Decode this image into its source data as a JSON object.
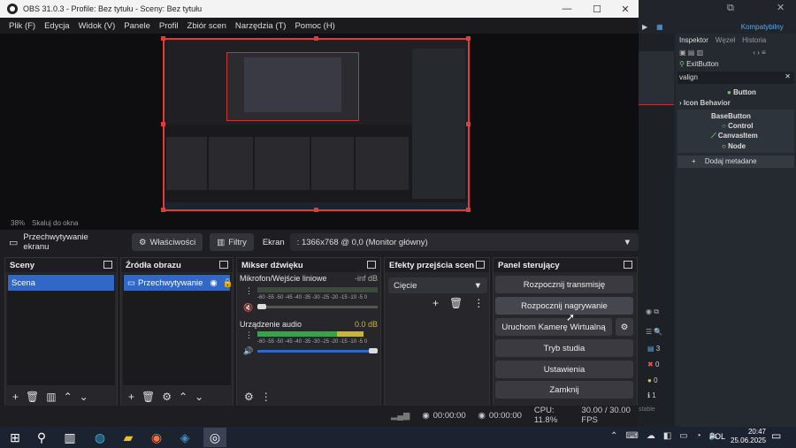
{
  "window": {
    "title": "OBS 31.0.3 - Profile: Bez tytułu - Sceny: Bez tytułu",
    "minimize": "—",
    "maximize": "☐",
    "close": "✕"
  },
  "menu": [
    "Plik (F)",
    "Edycja",
    "Widok (V)",
    "Panele",
    "Profil",
    "Zbiór scen",
    "Narzędzia (T)",
    "Pomoc (H)"
  ],
  "preview": {
    "zoom": "38%",
    "fit_label": "Skaluj do okna"
  },
  "source_bar": {
    "source_name": "Przechwytywanie ekranu",
    "properties": "Właściwości",
    "filters": "Filtry",
    "screen_label": "Ekran",
    "screen_value": ": 1366x768 @ 0,0 (Monitor główny)"
  },
  "scenes": {
    "title": "Sceny",
    "items": [
      "Scena"
    ]
  },
  "sources": {
    "title": "Źródła obrazu",
    "items": [
      "Przechwytywanie"
    ]
  },
  "mixer": {
    "title": "Mikser dźwięku",
    "channels": [
      {
        "name": "Mikrofon/Wejście liniowe",
        "level": "-inf dB",
        "muted": true,
        "volume": 0.05
      },
      {
        "name": "Urządzenie audio",
        "level": "0.0 dB",
        "muted": false,
        "volume": 1.0
      }
    ],
    "scale": "-60 -55 -50 -45 -40 -35 -30 -25 -20 -15 -10 -5 0"
  },
  "transitions": {
    "title": "Efekty przejścia scen",
    "selected": "Cięcie"
  },
  "controls": {
    "title": "Panel sterujący",
    "buttons": [
      "Rozpocznij transmisję",
      "Rozpocznij nagrywanie",
      "Uruchom Kamerę Wirtualną",
      "Tryb studia",
      "Ustawienia",
      "Zamknij"
    ]
  },
  "status": {
    "stream_time": "00:00:00",
    "rec_time": "00:00:00",
    "cpu": "CPU: 11.8%",
    "fps": "30.00 / 30.00 FPS"
  },
  "bg_editor": {
    "layout": "Kompatybilny",
    "tabs": [
      "Inspektor",
      "Węzeł",
      "Historia"
    ],
    "node": "ExitButton",
    "search": "valign",
    "type": "Button",
    "section": "Icon Behavior",
    "inherit": [
      "BaseButton",
      "Control",
      "CanvasItem",
      "Node"
    ],
    "add_meta": "Dodaj metadane",
    "counts": [
      "3",
      "0",
      "0",
      "1"
    ],
    "stable": "stable"
  },
  "taskbar": {
    "lang": "POL",
    "time": "20:47",
    "date": "25.06.2025"
  },
  "colors": {
    "accent": "#3167c7",
    "selection": "#e23b3b",
    "meter_green": "#3aa34a",
    "meter_yellow": "#c9b43a"
  }
}
